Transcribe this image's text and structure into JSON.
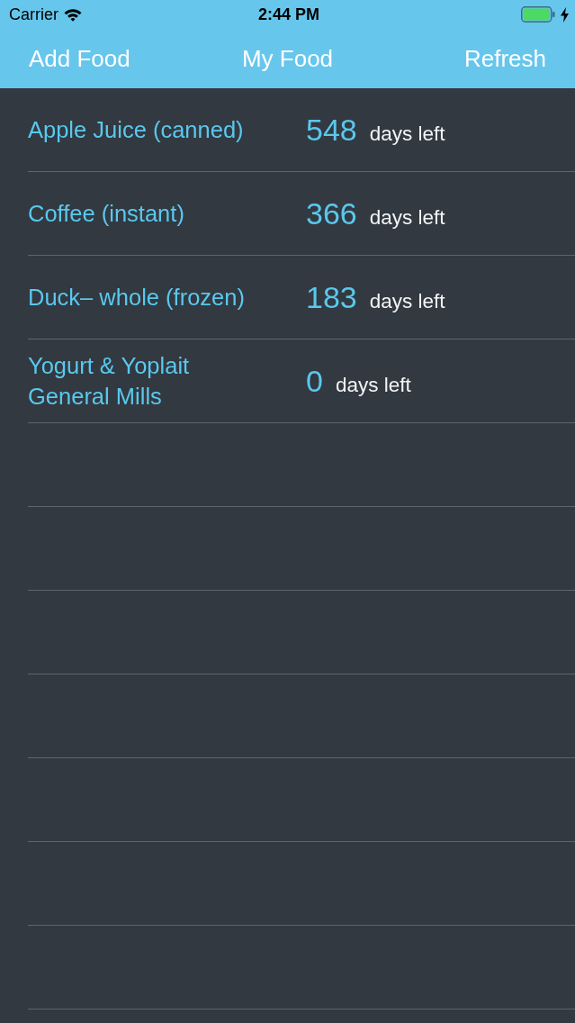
{
  "status_bar": {
    "carrier": "Carrier",
    "time": "2:44 PM"
  },
  "nav_bar": {
    "left_button": "Add Food",
    "title": "My Food",
    "right_button": "Refresh"
  },
  "foods": [
    {
      "name": "Apple Juice (canned)",
      "days": "548",
      "unit": "days left"
    },
    {
      "name": "Coffee (instant)",
      "days": "366",
      "unit": "days left"
    },
    {
      "name": "Duck– whole (frozen)",
      "days": "183",
      "unit": "days left"
    },
    {
      "name": "Yogurt & Yoplait General Mills",
      "days": "0",
      "unit": "days left"
    }
  ]
}
